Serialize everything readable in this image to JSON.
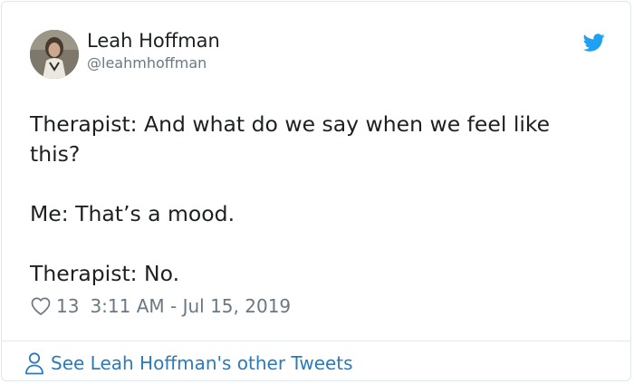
{
  "tweet": {
    "author": {
      "name": "Leah Hoffman",
      "handle": "@leahmhoffman"
    },
    "lines": [
      "Therapist: And what do we say when we feel like this?",
      "Me: That’s a mood.",
      "Therapist: No."
    ],
    "like_count": "13",
    "timestamp": "3:11 AM - Jul 15, 2019"
  },
  "footer": {
    "link_label": "See Leah Hoffman's other Tweets"
  },
  "icons": {
    "brand": "twitter-bird-icon",
    "like": "heart-outline-icon",
    "profile": "person-outline-icon"
  },
  "colors": {
    "brand_blue": "#1da1f2",
    "link_blue": "#2b7bb9",
    "text": "#1c2022",
    "muted": "#697882",
    "border": "#e1e8ed"
  }
}
